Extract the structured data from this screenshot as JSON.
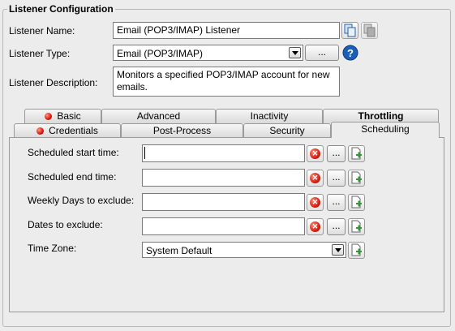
{
  "window": {
    "title": "Listener Configuration"
  },
  "fields": {
    "name": {
      "label": "Listener Name:",
      "value": "Email (POP3/IMAP) Listener"
    },
    "type": {
      "label": "Listener Type:",
      "value": "Email (POP3/IMAP)",
      "browse_label": "..."
    },
    "description": {
      "label": "Listener Description:",
      "value": "Monitors a specified POP3/IMAP account for new emails."
    }
  },
  "tabs": {
    "row1": [
      {
        "label": "Basic",
        "status": "error"
      },
      {
        "label": "Advanced"
      },
      {
        "label": "Inactivity"
      },
      {
        "label": "Throttling",
        "bold": true
      }
    ],
    "row2": [
      {
        "label": "Credentials",
        "status": "error"
      },
      {
        "label": "Post-Process"
      },
      {
        "label": "Security"
      },
      {
        "label": "Scheduling",
        "active": true
      }
    ]
  },
  "scheduling": {
    "start_time": {
      "label": "Scheduled start time:",
      "value": ""
    },
    "end_time": {
      "label": "Scheduled end time:",
      "value": ""
    },
    "weekly_days": {
      "label": "Weekly Days to exclude:",
      "value": ""
    },
    "dates": {
      "label": "Dates to exclude:",
      "value": ""
    },
    "time_zone": {
      "label": "Time Zone:",
      "value": "System Default"
    },
    "browse_label": "..."
  },
  "colors": {
    "error": "#e01b0b",
    "help": "#1c5fb8",
    "add_green": "#2e9b2e"
  },
  "icons": {
    "copy": "copy-icon",
    "clear": "clear-icon",
    "add": "add-variable-icon",
    "help": "help-icon",
    "error": "error-dot-icon"
  }
}
